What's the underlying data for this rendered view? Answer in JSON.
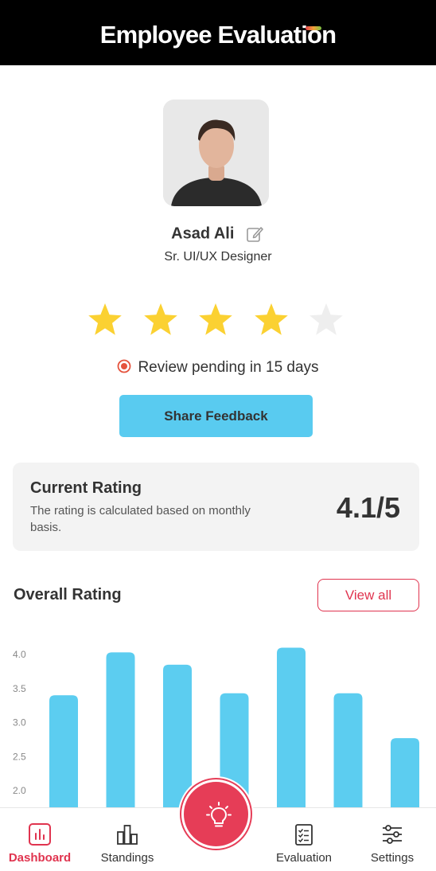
{
  "header": {
    "title": "Employee Evaluation"
  },
  "profile": {
    "name": "Asad Ali",
    "role": "Sr. UI/UX Designer",
    "stars_filled": 4,
    "stars_total": 5,
    "review_status": "Review pending in 15 days"
  },
  "share_button": {
    "label": "Share Feedback"
  },
  "current_rating": {
    "title": "Current Rating",
    "description": "The rating is calculated based on monthly basis.",
    "value": "4.1/5"
  },
  "overall_rating": {
    "title": "Overall Rating",
    "view_all_label": "View all"
  },
  "chart_data": {
    "type": "bar",
    "title": "Overall Rating",
    "y_ticks": [
      "4.0",
      "3.5",
      "3.0",
      "2.5",
      "2.0"
    ],
    "ylim_visible": [
      1.75,
      4.1
    ],
    "values": [
      3.4,
      4.03,
      3.85,
      3.43,
      4.1,
      3.43,
      2.77
    ],
    "color": "#5ccdf0",
    "grid": false
  },
  "nav": {
    "items": [
      {
        "label": "Dashboard",
        "icon": "dashboard-chart-icon",
        "active": true
      },
      {
        "label": "Standings",
        "icon": "bar-chart-icon",
        "active": false
      },
      {
        "label": "Evaluation",
        "icon": "checklist-icon",
        "active": false
      },
      {
        "label": "Settings",
        "icon": "sliders-icon",
        "active": false
      }
    ],
    "fab_icon": "lightbulb-icon"
  },
  "colors": {
    "accent": "#e0344f",
    "primary_button": "#59cbf0",
    "star_filled": "#fbd132",
    "star_empty": "#eeeeee"
  }
}
